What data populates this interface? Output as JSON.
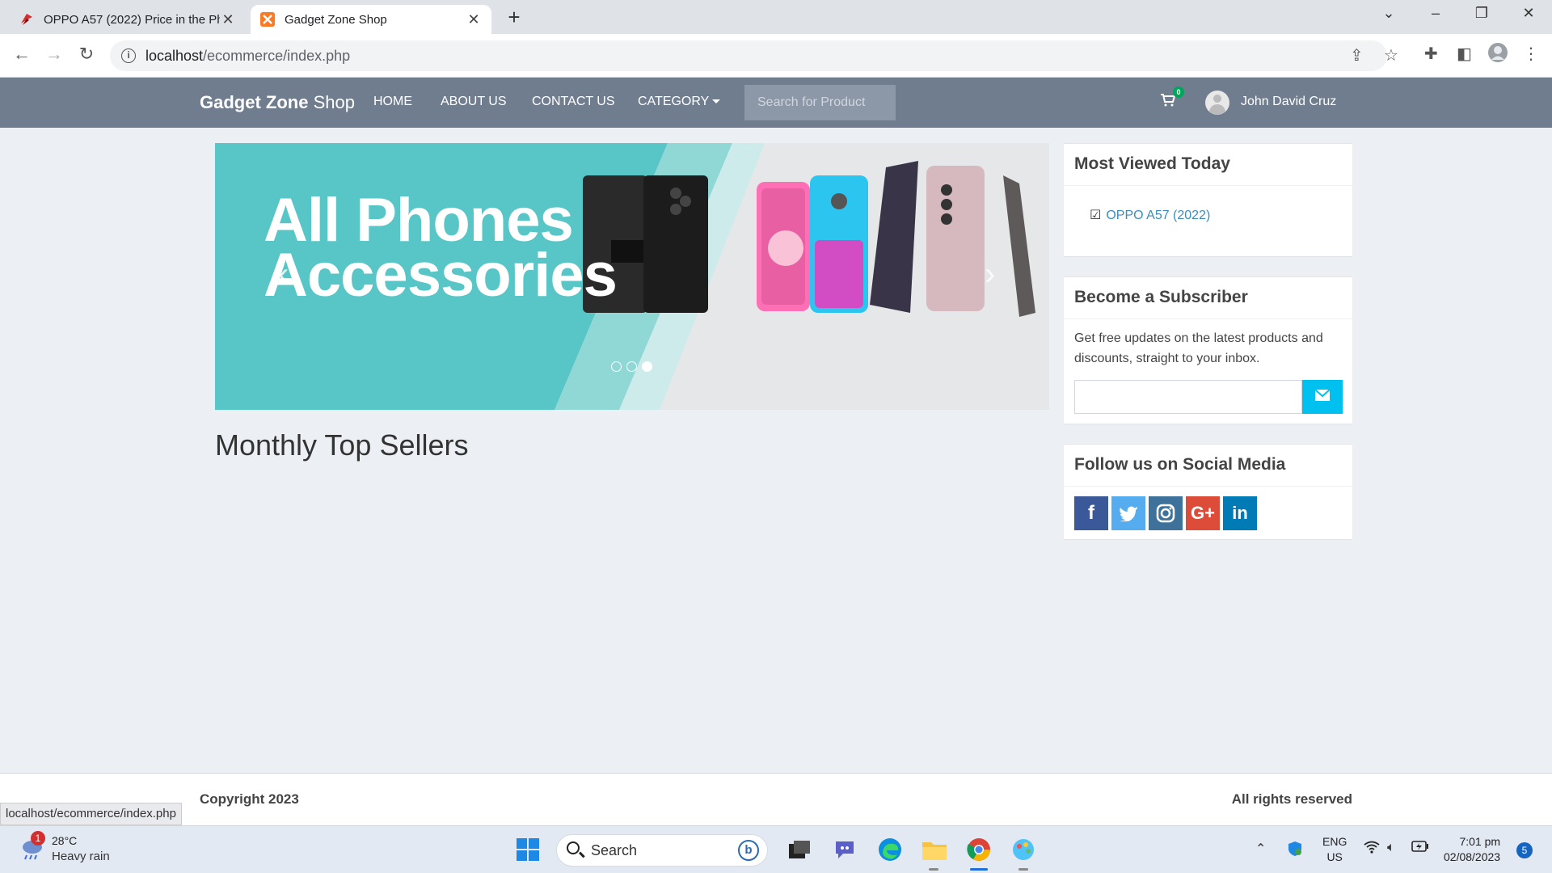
{
  "browser": {
    "tabs": [
      {
        "title": "OPPO A57 (2022) Price in the Phi",
        "favicon": "pricebook-logo-icon",
        "active": false
      },
      {
        "title": "Gadget Zone Shop",
        "favicon": "xampp-logo-icon",
        "active": true
      }
    ],
    "url_host": "localhost",
    "url_path": "/ecommerce/index.php",
    "status_url": "localhost/ecommerce/index.php"
  },
  "site": {
    "brand_bold": "Gadget Zone",
    "brand_light": " Shop",
    "nav": [
      "HOME",
      "ABOUT US",
      "CONTACT US",
      "CATEGORY"
    ],
    "search_placeholder": "Search for Product",
    "cart_count": "0",
    "user_name": "John David Cruz",
    "banner_line1": "All Phones",
    "banner_line2": "Accessories",
    "carousel_slides": 3,
    "carousel_active": 3,
    "section_title": "Monthly Top Sellers",
    "most_viewed": {
      "title": "Most Viewed Today",
      "items": [
        "OPPO A57 (2022)"
      ]
    },
    "subscriber": {
      "title": "Become a Subscriber",
      "text": "Get free updates on the latest products and discounts, straight to your inbox."
    },
    "social": {
      "title": "Follow us on Social Media",
      "icons": [
        "facebook-icon",
        "twitter-icon",
        "instagram-icon",
        "google-plus-icon",
        "linkedin-icon"
      ]
    },
    "footer_left": "Copyright 2023",
    "footer_right": "All rights reserved"
  },
  "taskbar": {
    "weather_temp": "28°C",
    "weather_desc": "Heavy rain",
    "weather_alerts": "1",
    "search_label": "Search",
    "lang_line1": "ENG",
    "lang_line2": "US",
    "time": "7:01 pm",
    "date": "02/08/2023",
    "notifications": "5"
  },
  "colors": {
    "navbar": "#707d8f",
    "banner_teal": "#58c5c6",
    "link": "#3c8dbc",
    "subscribe_button": "#00c0ef",
    "facebook": "#3b5998",
    "twitter": "#55acee",
    "instagram": "#3f729b",
    "google_plus": "#dd4b39",
    "linkedin": "#007bb6"
  }
}
